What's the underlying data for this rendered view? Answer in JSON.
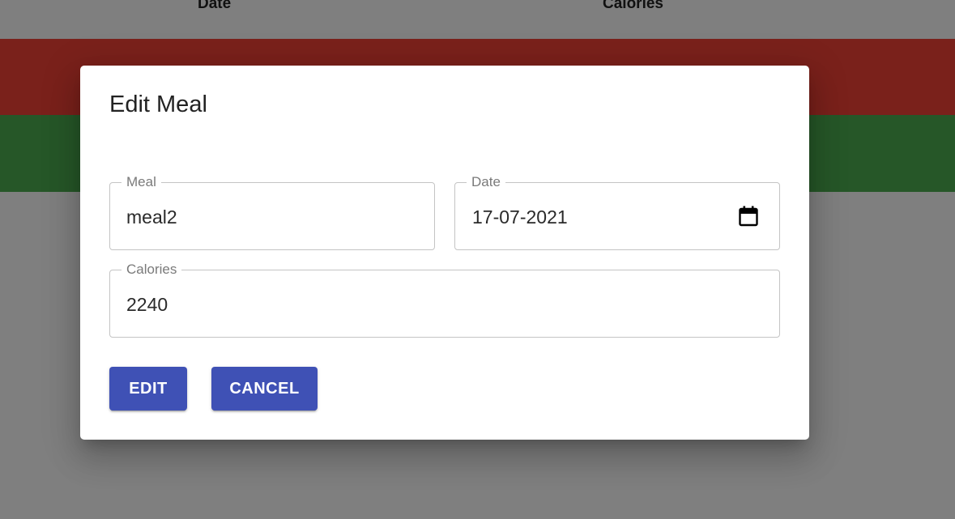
{
  "table": {
    "columns": [
      "Date",
      "Calories"
    ],
    "row_colors": [
      "#f44336",
      "#4caf50"
    ]
  },
  "dialog": {
    "title": "Edit Meal",
    "fields": {
      "meal": {
        "label": "Meal",
        "value": "meal2"
      },
      "date": {
        "label": "Date",
        "value": "17-07-2021",
        "icon": "calendar-icon"
      },
      "calories": {
        "label": "Calories",
        "value": "2240"
      }
    },
    "buttons": {
      "edit": "EDIT",
      "cancel": "CANCEL"
    }
  },
  "colors": {
    "primary": "#3f51b5",
    "backdrop": "rgba(0,0,0,0.5)"
  }
}
